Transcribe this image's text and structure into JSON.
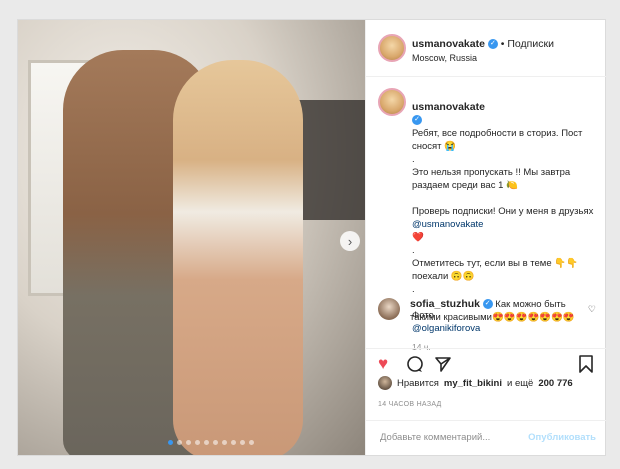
{
  "post": {
    "username": "usmanovakate",
    "follow_label": "• Подписки",
    "location": "Moscow, Russia",
    "caption": {
      "line1": "Ребят, все подробности в сториз. Пост сносят 😭",
      "dot1": ".",
      "line2": "Это нельзя пропускать !! Мы завтра раздаем среди вас 1 🍋",
      "line3": "Проверь подписки! Они у меня в друзьях",
      "mention1": "@usmanovakate",
      "heart": "❤️",
      "dot2": ".",
      "line4": "Отметитесь тут, если вы в теме 👇👇 поехали 🙃🙃",
      "dot3": ".",
      "photo_prefix": "Фото",
      "mention2": "@olganikiforova",
      "time": "14 ч."
    },
    "comment": {
      "username": "sofia_stuzhuk",
      "text": "Как можно быть такими красивыми😍😍😍😍😍😍😍"
    },
    "actions": {
      "like_icon": "heart-icon",
      "comment_icon": "comment-icon",
      "share_icon": "share-icon",
      "save_icon": "bookmark-icon"
    },
    "likes": {
      "prefix": "Нравится",
      "user": "my_fit_bikini",
      "middle": "и ещё",
      "count": "200 776"
    },
    "ago": "14 ЧАСОВ НАЗАД",
    "add_comment_placeholder": "Добавьте комментарий...",
    "publish_label": "Опубликовать"
  },
  "colors": {
    "accent": "#3897f0",
    "like": "#ed4956",
    "publish_disabled": "#b2dffc"
  }
}
